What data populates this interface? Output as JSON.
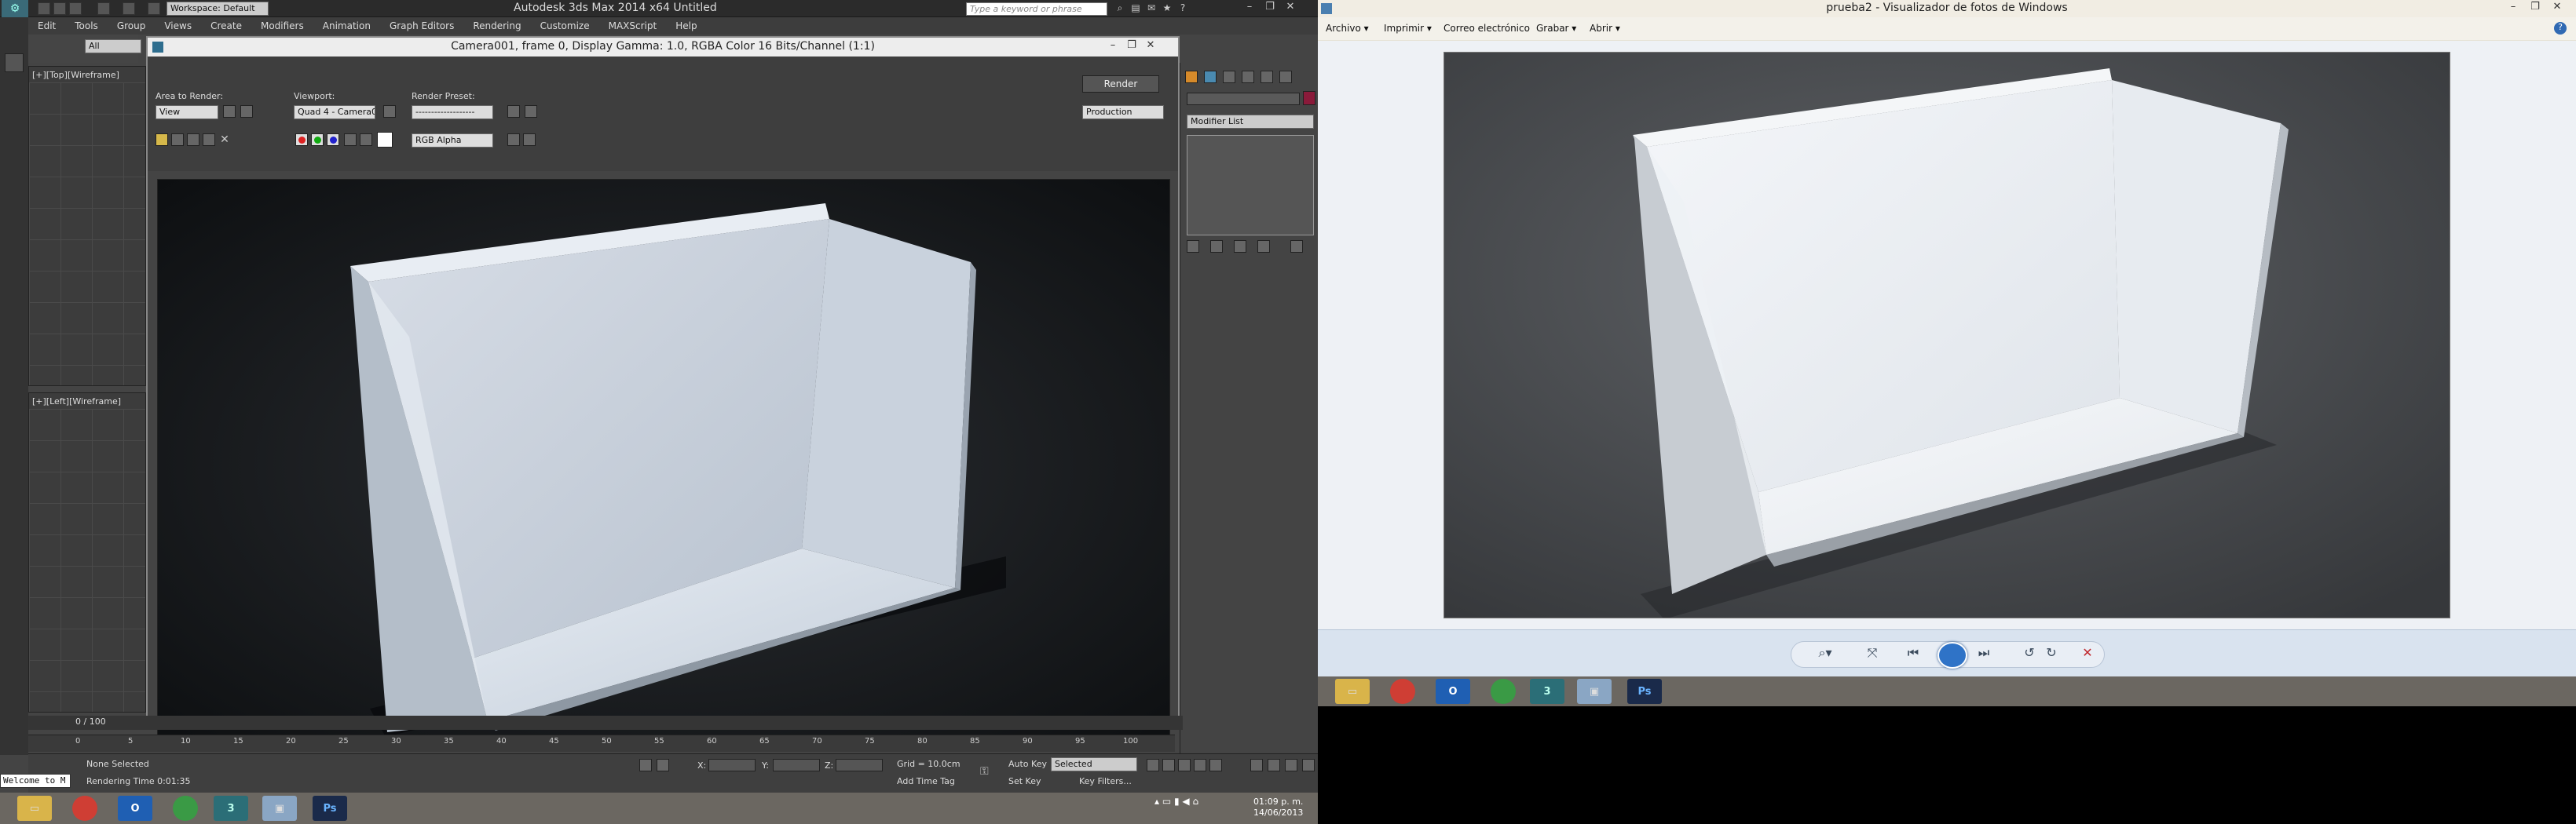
{
  "max": {
    "title": "Autodesk 3ds Max  2014 x64      Untitled",
    "workspace": "Workspace: Default",
    "search_placeholder": "Type a keyword or phrase",
    "menu": [
      "Edit",
      "Tools",
      "Group",
      "Views",
      "Create",
      "Modifiers",
      "Animation",
      "Graph Editors",
      "Rendering",
      "Customize",
      "MAXScript",
      "Help"
    ],
    "selection_filter": "All",
    "viewport_top_label": "[+][Top][Wireframe]",
    "viewport_left_label": "[+][Left][Wireframe]"
  },
  "render_frame": {
    "title": "Camera001, frame 0, Display Gamma: 1.0, RGBA Color 16 Bits/Channel (1:1)",
    "area_label": "Area to Render:",
    "area_value": "View",
    "viewport_label": "Viewport:",
    "viewport_value": "Quad 4 - Camera0",
    "preset_label": "Render Preset:",
    "preset_value": "-------------------",
    "render_button": "Render",
    "production_value": "Production",
    "channel_value": "RGB Alpha"
  },
  "command_panel": {
    "modifier_list": "Modifier List"
  },
  "timeline": {
    "counter": "0 / 100",
    "ticks": [
      "0",
      "5",
      "10",
      "15",
      "20",
      "25",
      "30",
      "35",
      "40",
      "45",
      "50",
      "55",
      "60",
      "65",
      "70",
      "75",
      "80",
      "85",
      "90",
      "95",
      "100"
    ]
  },
  "status": {
    "selection": "None Selected",
    "render_time": "Rendering Time  0:01:35",
    "x_label": "X:",
    "y_label": "Y:",
    "z_label": "Z:",
    "grid": "Grid = 10.0cm",
    "add_time_tag": "Add Time Tag",
    "auto_key": "Auto Key",
    "set_key": "Set Key",
    "selected_value": "Selected",
    "key_filters": "Key Filters...",
    "welcome": "Welcome to M"
  },
  "taskbar_left": {
    "clock_time": "01:09 p. m.",
    "clock_date": "14/06/2013"
  },
  "photo_viewer": {
    "title": "prueba2 - Visualizador de fotos de Windows",
    "menu": [
      "Archivo ▾",
      "Imprimir ▾",
      "Correo electrónico",
      "Grabar ▾",
      "Abrir ▾"
    ],
    "help": "?"
  },
  "taskbar_icons": [
    "folder-icon",
    "chrome-icon",
    "outlook-icon",
    "chrome-alt-icon",
    "3dsmax-icon",
    "photo-viewer-icon",
    "photoshop-icon"
  ],
  "colors": {
    "max_bg": "#444444",
    "render_bg": "#111111",
    "viewer_bg": "#eef1f5",
    "taskbar": "#6b6761",
    "accent_blue": "#2f73c7"
  }
}
